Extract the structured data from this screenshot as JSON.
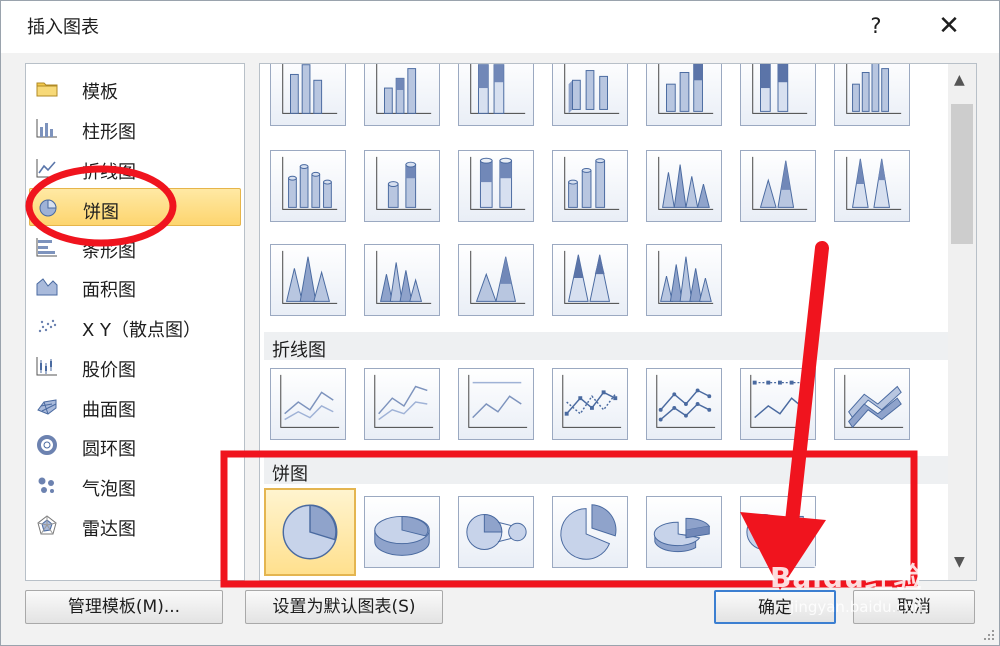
{
  "dialog": {
    "title": "插入图表",
    "help_label": "?",
    "close_label": "✕"
  },
  "chart_types": [
    {
      "label": "模板",
      "icon": "folder-icon"
    },
    {
      "label": "柱形图",
      "icon": "column-chart-icon"
    },
    {
      "label": "折线图",
      "icon": "line-chart-icon"
    },
    {
      "label": "饼图",
      "icon": "pie-chart-icon",
      "selected": true
    },
    {
      "label": "条形图",
      "icon": "bar-chart-icon"
    },
    {
      "label": "面积图",
      "icon": "area-chart-icon"
    },
    {
      "label": "X Y（散点图）",
      "icon": "scatter-chart-icon"
    },
    {
      "label": "股价图",
      "icon": "stock-chart-icon"
    },
    {
      "label": "曲面图",
      "icon": "surface-chart-icon"
    },
    {
      "label": "圆环图",
      "icon": "doughnut-chart-icon"
    },
    {
      "label": "气泡图",
      "icon": "bubble-chart-icon"
    },
    {
      "label": "雷达图",
      "icon": "radar-chart-icon"
    }
  ],
  "gallery": {
    "sections": [
      {
        "label": "折线图"
      },
      {
        "label": "饼图"
      }
    ],
    "selected_thumbnail": "pie-chart-thumb-1"
  },
  "buttons": {
    "manage_templates": "管理模板(M)...",
    "set_default": "设置为默认图表(S)",
    "ok": "确定",
    "cancel": "取消"
  },
  "watermark": {
    "brand": "Baidu经验",
    "url": "jingyan.baidu.com"
  },
  "colors": {
    "selection_fill": "#fdd56f",
    "annotation_red": "#f0141e",
    "thumb_blue": "#4a6aa0"
  }
}
